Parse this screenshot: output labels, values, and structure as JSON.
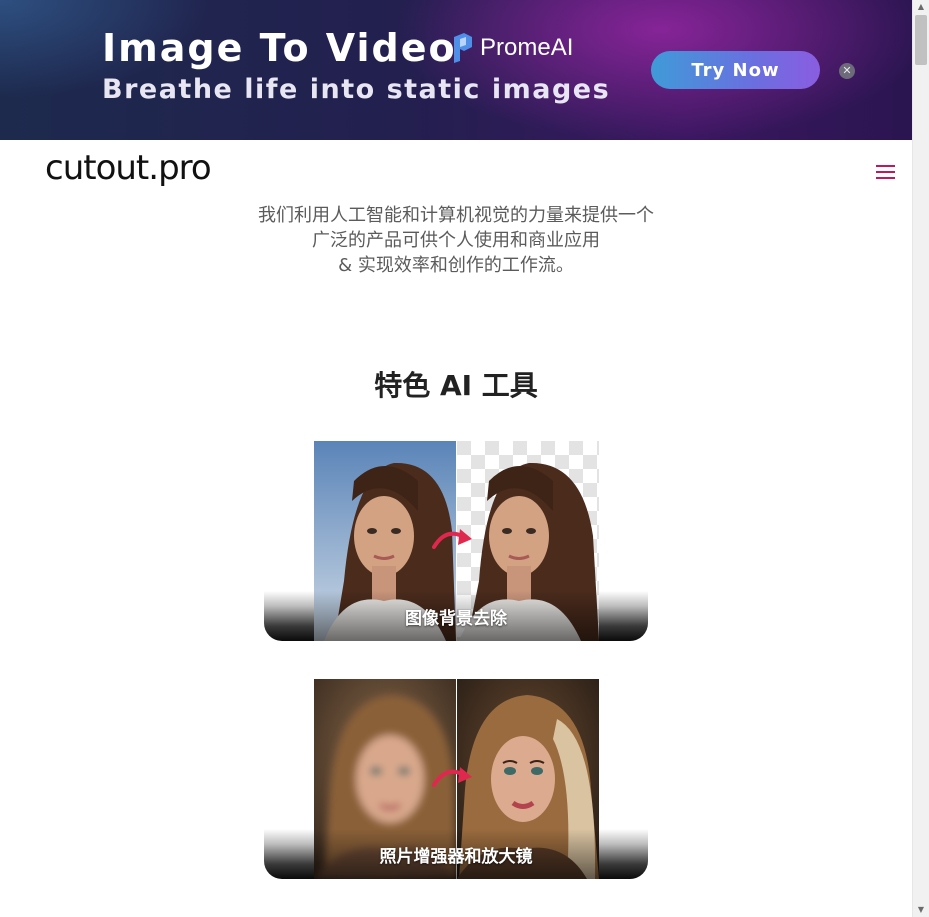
{
  "banner": {
    "title": "Image To Video",
    "subtitle": "Breathe life into static images",
    "brand": "PromeAI",
    "cta_label": "Try Now",
    "close_symbol": "✕",
    "colors": {
      "cta_start": "#3f9bd8",
      "cta_end": "#8a5de0",
      "background": "#231f4f"
    }
  },
  "header": {
    "logo": "cutout.pro",
    "menu_icon": "hamburger-menu-icon",
    "accent_color": "#c2185b"
  },
  "intro": {
    "lines": [
      "我们利用人工智能和计算机视觉的力量来提供一个",
      "广泛的产品可供个人使用和商业应用",
      "& 实现效率和创作的工作流。"
    ]
  },
  "featured": {
    "title": "特色 AI 工具",
    "tools": [
      {
        "label": "图像背景去除",
        "icon": "background-removal-image"
      },
      {
        "label": "照片增强器和放大镜",
        "icon": "photo-enhancer-image"
      }
    ]
  }
}
